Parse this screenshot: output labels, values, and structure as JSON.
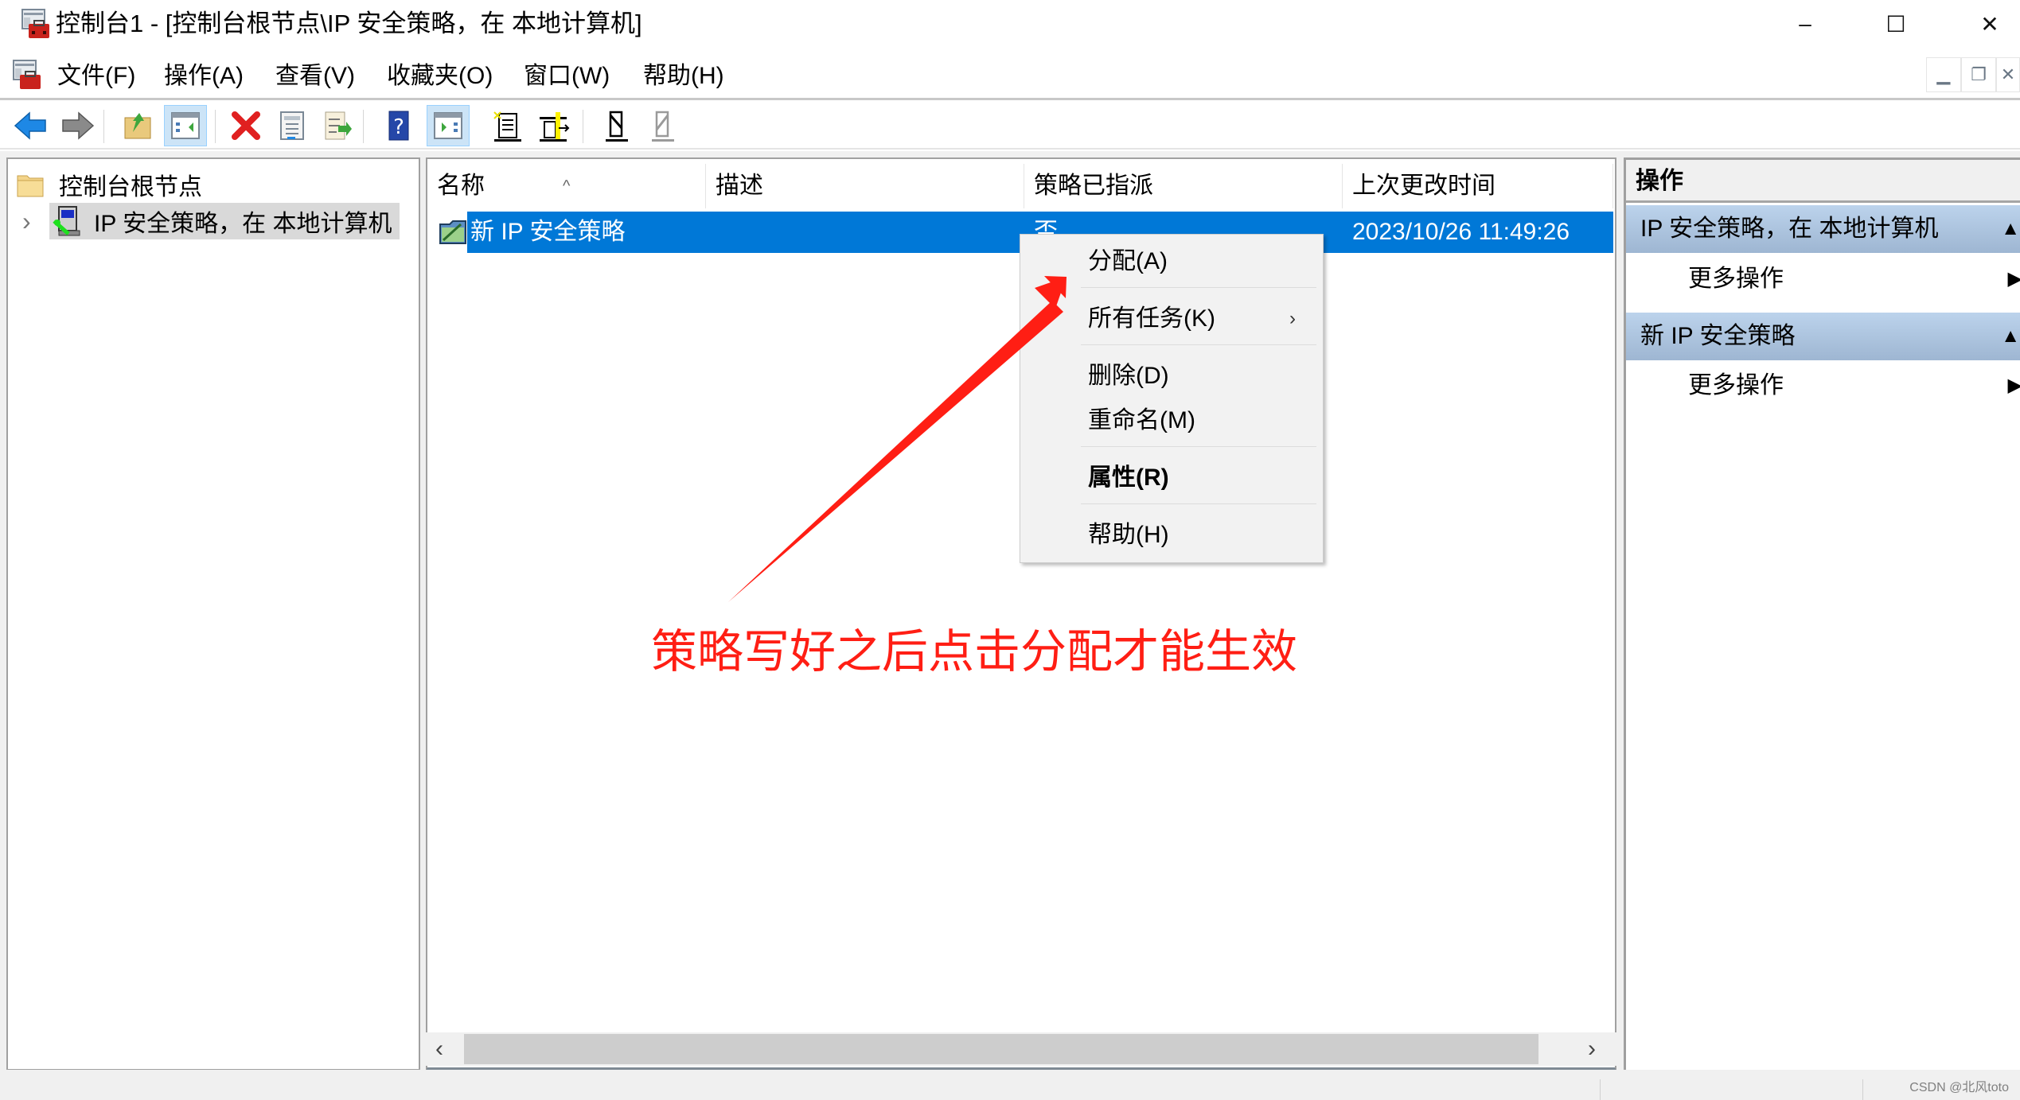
{
  "window": {
    "title": "控制台1 - [控制台根节点\\IP 安全策略，在 本地计算机]",
    "minimize": "–",
    "maximize": "☐",
    "close": "✕"
  },
  "menubar": {
    "items": [
      "文件(F)",
      "操作(A)",
      "查看(V)",
      "收藏夹(O)",
      "窗口(W)",
      "帮助(H)"
    ],
    "mdi_minimize": "▁",
    "mdi_restore": "❐",
    "mdi_close": "✕"
  },
  "toolbar": {
    "buttons": [
      {
        "icon": "back-arrow-icon"
      },
      {
        "icon": "forward-arrow-icon"
      },
      {
        "icon": "up-folder-icon"
      },
      {
        "icon": "show-hide-console-tree-icon",
        "active": true
      },
      {
        "icon": "delete-icon"
      },
      {
        "icon": "properties-icon"
      },
      {
        "icon": "export-list-icon"
      },
      {
        "icon": "help-icon"
      },
      {
        "icon": "show-hide-action-pane-icon",
        "active": true
      },
      {
        "icon": "create-ip-policy-icon"
      },
      {
        "icon": "manage-filter-lists-icon"
      },
      {
        "icon": "assign-policy-icon"
      },
      {
        "icon": "unassign-policy-icon"
      }
    ]
  },
  "tree": {
    "root_label": "控制台根节点",
    "child_label": "IP 安全策略，在 本地计算机",
    "child_expander": "›"
  },
  "list": {
    "sort_indicator": "^",
    "columns": [
      "名称",
      "描述",
      "策略已指派",
      "上次更改时间"
    ],
    "rows": [
      {
        "name": "新 IP 安全策略",
        "description": "",
        "assigned": "否",
        "modified": "2023/10/26 11:49:26",
        "selected": true
      }
    ]
  },
  "context_menu": {
    "items": [
      {
        "label": "分配(A)"
      },
      {
        "label": "所有任务(K)",
        "submenu": true
      },
      {
        "label": "删除(D)"
      },
      {
        "label": "重命名(M)"
      },
      {
        "label": "属性(R)",
        "bold": true
      },
      {
        "label": "帮助(H)"
      }
    ],
    "submenu_arrow": "›"
  },
  "scrollbar": {
    "left_arrow": "‹",
    "right_arrow": "›"
  },
  "actions_pane": {
    "title": "操作",
    "groups": [
      {
        "label": "IP 安全策略，在 本地计算机",
        "items": [
          "更多操作"
        ]
      },
      {
        "label": "新 IP 安全策略",
        "items": [
          "更多操作"
        ]
      }
    ],
    "collapse_glyph": "▲",
    "expand_glyph": "▶"
  },
  "annotation": {
    "text": "策略写好之后点击分配才能生效",
    "color": "#ff1e14"
  },
  "colors": {
    "selection": "#0078d7",
    "action_group": "#b0c7e2",
    "menu_bg": "#f2f2f2"
  },
  "watermark": "CSDN @北风toto"
}
